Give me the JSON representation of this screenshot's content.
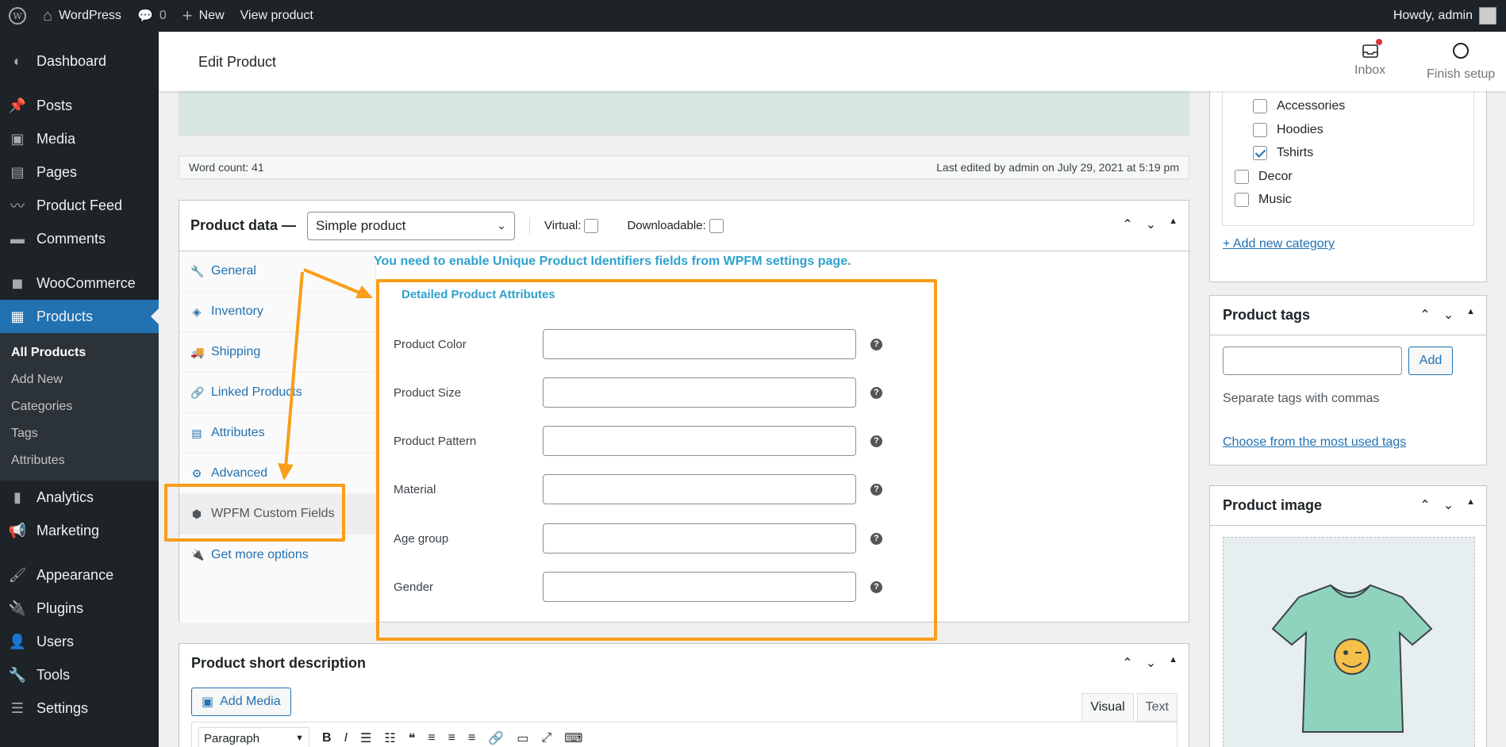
{
  "adminbar": {
    "site_name": "WordPress",
    "comments_count": "0",
    "new_label": "New",
    "view_label": "View product",
    "howdy": "Howdy, admin"
  },
  "sidebar": {
    "items": [
      {
        "label": "Dashboard",
        "icon": "gauge-icon"
      },
      {
        "label": "Posts",
        "icon": "pin-icon"
      },
      {
        "label": "Media",
        "icon": "media-icon"
      },
      {
        "label": "Pages",
        "icon": "pages-icon"
      },
      {
        "label": "Product Feed",
        "icon": "feed-icon"
      },
      {
        "label": "Comments",
        "icon": "comment-icon"
      },
      {
        "label": "WooCommerce",
        "icon": "woo-icon"
      },
      {
        "label": "Products",
        "icon": "archive-icon"
      },
      {
        "label": "Analytics",
        "icon": "chart-icon"
      },
      {
        "label": "Marketing",
        "icon": "megaphone-icon"
      },
      {
        "label": "Appearance",
        "icon": "brush-icon"
      },
      {
        "label": "Plugins",
        "icon": "plugin-icon"
      },
      {
        "label": "Users",
        "icon": "user-icon"
      },
      {
        "label": "Tools",
        "icon": "wrench-icon"
      },
      {
        "label": "Settings",
        "icon": "settings-icon"
      }
    ],
    "submenu": [
      "All Products",
      "Add New",
      "Categories",
      "Tags",
      "Attributes"
    ]
  },
  "header": {
    "title": "Edit Product",
    "inbox_label": "Inbox",
    "finish_label": "Finish setup"
  },
  "status_bar": {
    "word_count": "Word count: 41",
    "last_edited": "Last edited by admin on July 29, 2021 at 5:19 pm"
  },
  "product_data": {
    "title": "Product data —",
    "type_selected": "Simple product",
    "virtual_label": "Virtual:",
    "downloadable_label": "Downloadable:",
    "tabs": [
      "General",
      "Inventory",
      "Shipping",
      "Linked Products",
      "Attributes",
      "Advanced",
      "WPFM Custom Fields",
      "Get more options"
    ],
    "notice": "You need to enable Unique Product Identifiers fields from WPFM settings page.",
    "section_title": "Detailed Product Attributes",
    "fields": [
      {
        "label": "Product Color",
        "value": ""
      },
      {
        "label": "Product Size",
        "value": ""
      },
      {
        "label": "Product Pattern",
        "value": ""
      },
      {
        "label": "Material",
        "value": ""
      },
      {
        "label": "Age group",
        "value": ""
      },
      {
        "label": "Gender",
        "value": ""
      }
    ]
  },
  "short_desc": {
    "title": "Product short description",
    "add_media": "Add Media",
    "visual": "Visual",
    "text": "Text",
    "format": "Paragraph"
  },
  "categories": {
    "items": [
      {
        "label": "Accessories",
        "checked": false
      },
      {
        "label": "Hoodies",
        "checked": false
      },
      {
        "label": "Tshirts",
        "checked": true
      },
      {
        "label": "Decor",
        "checked": false
      },
      {
        "label": "Music",
        "checked": false
      }
    ],
    "add_new": "+ Add new category"
  },
  "tags": {
    "title": "Product tags",
    "add": "Add",
    "hint": "Separate tags with commas",
    "choose": "Choose from the most used tags"
  },
  "image": {
    "title": "Product image"
  },
  "colors": {
    "accent": "#2271b1",
    "highlight": "#f99d1b",
    "admin_dark": "#1d2327"
  }
}
